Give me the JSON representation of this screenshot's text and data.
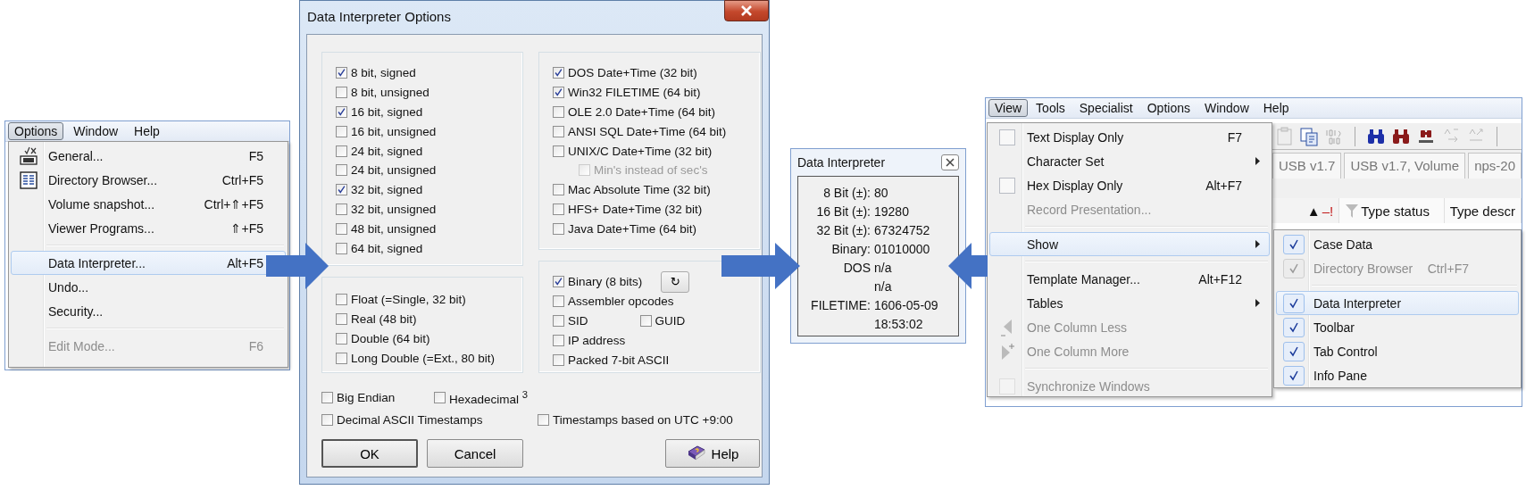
{
  "options_window": {
    "menubar": [
      {
        "label": "Options",
        "selected": true
      },
      {
        "label": "Window",
        "selected": false
      },
      {
        "label": "Help",
        "selected": false
      }
    ],
    "menu": [
      {
        "label": "General...",
        "shortcut": "F5",
        "kind": "general",
        "selected": false,
        "disabled": false
      },
      {
        "label": "Directory Browser...",
        "shortcut": "Ctrl+F5",
        "kind": "directory",
        "selected": false,
        "disabled": false
      },
      {
        "label": "Volume snapshot...",
        "shortcut": "Ctrl+⇑+F5",
        "kind": "plain",
        "selected": false,
        "disabled": false
      },
      {
        "label": "Viewer Programs...",
        "shortcut": "⇑+F5",
        "kind": "plain",
        "selected": false,
        "disabled": false
      },
      {
        "kind": "separator"
      },
      {
        "label": "Data Interpreter...",
        "shortcut": "Alt+F5",
        "kind": "plain",
        "selected": true,
        "disabled": false
      },
      {
        "label": "Undo...",
        "kind": "plain",
        "selected": false,
        "disabled": false
      },
      {
        "label": "Security...",
        "kind": "plain",
        "selected": false,
        "disabled": false
      },
      {
        "kind": "separator"
      },
      {
        "label": "Edit Mode...",
        "shortcut": "F6",
        "kind": "plain",
        "selected": false,
        "disabled": true
      }
    ]
  },
  "options_dialog": {
    "title": "Data Interpreter Options",
    "integer_options": [
      {
        "label": "8 bit, signed",
        "checked": true
      },
      {
        "label": "8 bit, unsigned",
        "checked": false
      },
      {
        "label": "16 bit, signed",
        "checked": true
      },
      {
        "label": "16 bit, unsigned",
        "checked": false
      },
      {
        "label": "24 bit, signed",
        "checked": false
      },
      {
        "label": "24 bit, unsigned",
        "checked": false
      },
      {
        "label": "32 bit, signed",
        "checked": true
      },
      {
        "label": "32 bit, unsigned",
        "checked": false
      },
      {
        "label": "48 bit, unsigned",
        "checked": false
      },
      {
        "label": "64 bit, signed",
        "checked": false
      }
    ],
    "float_options": [
      {
        "label": "Float (=Single, 32 bit)",
        "checked": false
      },
      {
        "label": "Real (48 bit)",
        "checked": false
      },
      {
        "label": "Double (64 bit)",
        "checked": false
      },
      {
        "label": "Long Double (=Ext., 80 bit)",
        "checked": false
      }
    ],
    "date_options": [
      {
        "label": "DOS Date+Time (32 bit)",
        "checked": true
      },
      {
        "label": "Win32 FILETIME (64 bit)",
        "checked": true
      },
      {
        "label": "OLE 2.0 Date+Time (64 bit)",
        "checked": false
      },
      {
        "label": "ANSI SQL Date+Time (64 bit)",
        "checked": false
      },
      {
        "label": "UNIX/C Date+Time (32 bit)",
        "checked": false,
        "children": [
          {
            "label": "Min's instead of sec's",
            "checked": false,
            "disabled": true
          }
        ]
      },
      {
        "label": "Mac Absolute Time (32 bit)",
        "checked": false
      },
      {
        "label": "HFS+ Date+Time (32 bit)",
        "checked": false
      },
      {
        "label": "Java Date+Time (64 bit)",
        "checked": false
      }
    ],
    "other_options": [
      {
        "options": [
          {
            "label": "Binary (8 bits)",
            "checked": true
          }
        ],
        "button": "↻"
      },
      {
        "options": [
          {
            "label": "Assembler opcodes",
            "checked": false
          }
        ]
      },
      {
        "options": [
          {
            "label": "SID",
            "checked": false
          },
          {
            "label": "GUID",
            "checked": false
          }
        ]
      },
      {
        "options": [
          {
            "label": "IP address",
            "checked": false
          }
        ]
      },
      {
        "options": [
          {
            "label": "Packed 7-bit ASCII",
            "checked": false
          }
        ]
      }
    ],
    "bottom_options": [
      {
        "options": [
          {
            "label": "Big Endian",
            "checked": false
          },
          {
            "label": "Hexadecimal $^{3}$",
            "checked": false
          }
        ]
      },
      {
        "options": [
          {
            "label": "Decimal ASCII Timestamps",
            "checked": false
          },
          {
            "label": "Timestamps based on UTC +9:00",
            "checked": false
          }
        ]
      }
    ],
    "buttons": [
      {
        "label": "OK",
        "kind": "default"
      },
      {
        "label": "Cancel",
        "kind": "plain"
      },
      {
        "label": "Help",
        "kind": "help"
      }
    ]
  },
  "interpreter_panel": {
    "title": "Data Interpreter",
    "rows": [
      {
        "label": "8 Bit (±):",
        "value": "80"
      },
      {
        "label": "16 Bit (±):",
        "value": "19280"
      },
      {
        "label": "32 Bit (±):",
        "value": "67324752"
      },
      {
        "label": "Binary:",
        "value": "01010000"
      },
      {
        "label": "DOS",
        "value": "n/a"
      },
      {
        "value": "n/a"
      },
      {
        "label": "FILETIME:",
        "value": "1606-05-09"
      },
      {
        "value": "18:53:02"
      }
    ]
  },
  "view_window": {
    "menubar": [
      {
        "label": "View",
        "selected": true
      },
      {
        "label": "Tools",
        "selected": false
      },
      {
        "label": "Specialist",
        "selected": false
      },
      {
        "label": "Options",
        "selected": false
      },
      {
        "label": "Window",
        "selected": false
      },
      {
        "label": "Help",
        "selected": false
      }
    ],
    "tabs": [
      {
        "label": "USB v1.7",
        "selected": false
      },
      {
        "label": "USB v1.7, Volume",
        "selected": false
      },
      {
        "label": "nps-20",
        "selected": false
      }
    ],
    "columns": [
      {
        "label": "▲",
        "flag": "–!"
      },
      {
        "label": "Type status",
        "filter": true
      },
      {
        "label": "Type descr"
      }
    ],
    "menu": [
      {
        "label": "Text Display Only",
        "shortcut": "F7",
        "kind": "checkbox",
        "checked": false,
        "selected": false,
        "disabled": false
      },
      {
        "label": "Character Set",
        "kind": "plain",
        "submenu": true,
        "selected": false,
        "disabled": false
      },
      {
        "label": "Hex Display Only",
        "shortcut": "Alt+F7",
        "kind": "checkbox",
        "checked": false,
        "selected": false,
        "disabled": false
      },
      {
        "label": "Record Presentation...",
        "kind": "plain",
        "selected": false,
        "disabled": true
      },
      {
        "kind": "separator"
      },
      {
        "label": "Show",
        "kind": "plain",
        "submenu": true,
        "selected": true,
        "disabled": false
      },
      {
        "kind": "separator"
      },
      {
        "label": "Template Manager...",
        "shortcut": "Alt+F12",
        "kind": "plain",
        "selected": false,
        "disabled": false
      },
      {
        "label": "Tables",
        "kind": "plain",
        "submenu": true,
        "selected": false,
        "disabled": false
      },
      {
        "label": "One Column Less",
        "kind": "column_less",
        "selected": false,
        "disabled": true
      },
      {
        "label": "One Column More",
        "kind": "column_more",
        "selected": false,
        "disabled": true
      },
      {
        "kind": "separator"
      },
      {
        "label": "Synchronize Windows",
        "kind": "checkbox",
        "checked": false,
        "selected": false,
        "disabled": true
      }
    ],
    "submenu": [
      {
        "label": "Case Data",
        "checked": true,
        "selected": false,
        "disabled": false
      },
      {
        "label": "Directory Browser",
        "shortcut": "Ctrl+F7",
        "checked": true,
        "selected": false,
        "disabled": true
      },
      {
        "kind": "separator"
      },
      {
        "label": "Data Interpreter",
        "checked": true,
        "selected": true,
        "disabled": false
      },
      {
        "label": "Toolbar",
        "checked": true,
        "selected": false,
        "disabled": false
      },
      {
        "label": "Tab Control",
        "checked": true,
        "selected": false,
        "disabled": false
      },
      {
        "label": "Info Pane",
        "checked": true,
        "selected": false,
        "disabled": false
      }
    ]
  }
}
